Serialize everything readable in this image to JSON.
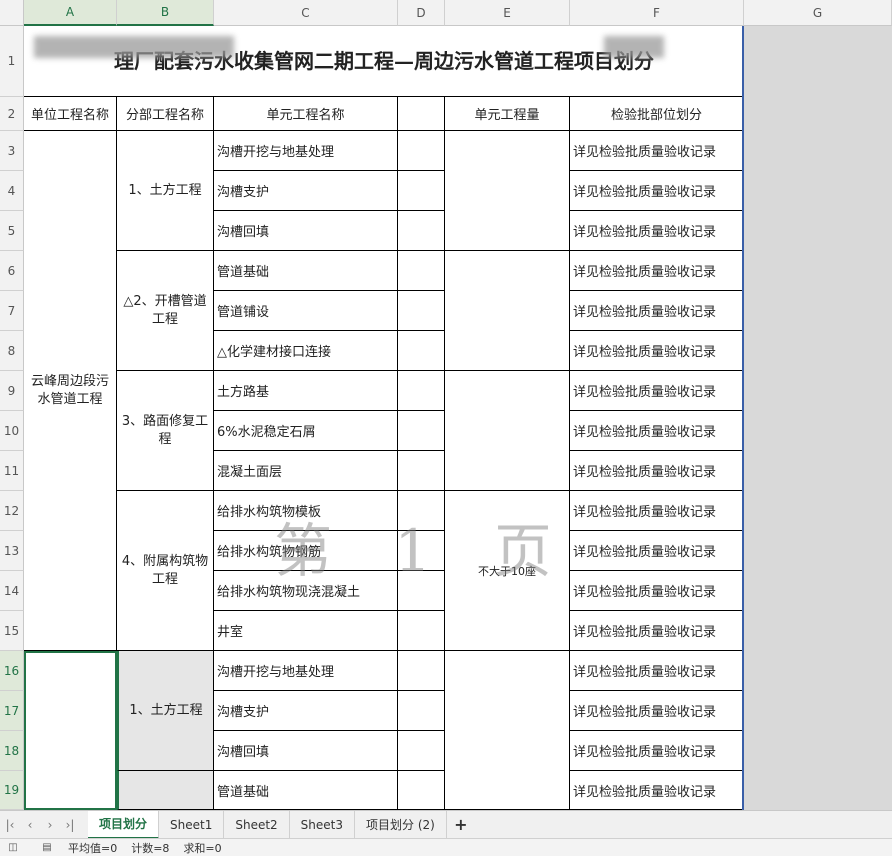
{
  "columns": [
    "A",
    "B",
    "C",
    "D",
    "E",
    "F",
    "G"
  ],
  "rows": [
    "1",
    "2",
    "3",
    "4",
    "5",
    "6",
    "7",
    "8",
    "9",
    "10",
    "11",
    "12",
    "13",
    "14",
    "15",
    "16",
    "17",
    "18",
    "19"
  ],
  "title": "理厂配套污水收集管网二期工程—周边污水管道工程项目划分",
  "headers": {
    "unit_project": "单位工程名称",
    "sub_project": "分部工程名称",
    "element_project": "单元工程名称",
    "element_qty": "单元工程量",
    "inspection": "检验批部位划分"
  },
  "unit_project_1": "云峰周边段污水管道工程",
  "sub_projects": [
    "1、土方工程",
    "△2、开槽管道工程",
    "3、路面修复工程",
    "4、附属构筑物工程",
    "1、土方工程"
  ],
  "elements": [
    "沟槽开挖与地基处理",
    "沟槽支护",
    "沟槽回填",
    "管道基础",
    "管道铺设",
    "△化学建材接口连接",
    "土方路基",
    "6%水泥稳定石屑",
    "混凝土面层",
    "给排水构筑物模板",
    "给排水构筑物钢筋",
    "给排水构筑物现浇混凝土",
    "井室",
    "沟槽开挖与地基处理",
    "沟槽支护",
    "沟槽回填",
    "管道基础"
  ],
  "inspection_text": "详见检验批质量验收记录",
  "qty_note": "不大于10座",
  "watermark": "第 1 页",
  "tabs": [
    "项目划分",
    "Sheet1",
    "Sheet2",
    "Sheet3",
    "项目划分 (2)"
  ],
  "add_tab": "+",
  "status": {
    "average": "平均值=0",
    "count": "计数=8",
    "sum": "求和=0"
  }
}
